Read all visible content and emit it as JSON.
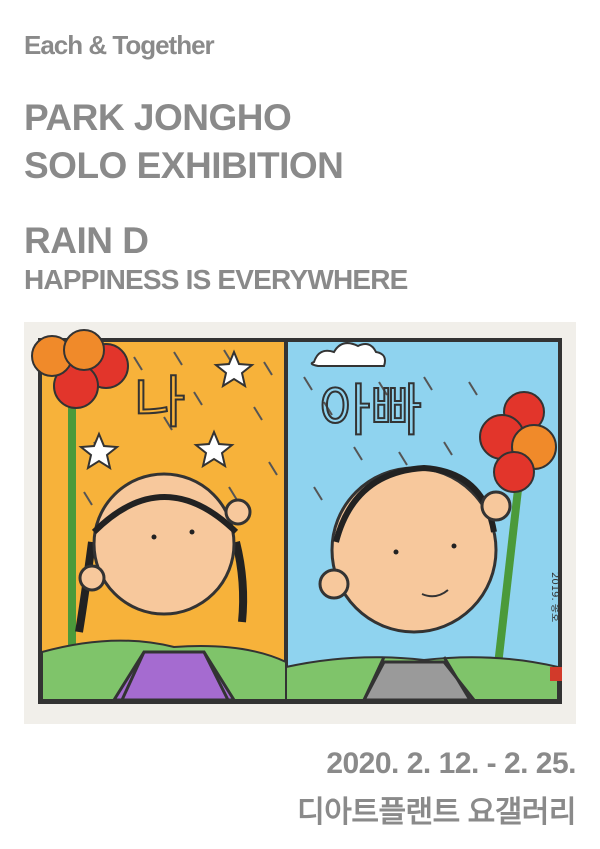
{
  "poster": {
    "tagline": "Each & Together",
    "artist_line1": "PARK JONGHO",
    "artist_line2": "SOLO EXHIBITION",
    "series_title": "RAIN D",
    "subtitle": "HAPPINESS IS EVERYWHERE",
    "dates": "2020. 2. 12. - 2. 25.",
    "venue": "디아트플랜트 요갤러리"
  },
  "artwork": {
    "left_word": "나",
    "right_word": "아빠",
    "signature": "2019. 종호",
    "colors": {
      "left_sky": "#f7b23a",
      "right_sky": "#8fd3ef",
      "ground": "#7fc46a",
      "skin": "#f7c89c",
      "girl_shirt": "#a56bd0",
      "boy_shirt": "#9a9a9a",
      "flower_red": "#e2352b",
      "flower_orange": "#f08a2a",
      "outline": "#333333"
    }
  }
}
